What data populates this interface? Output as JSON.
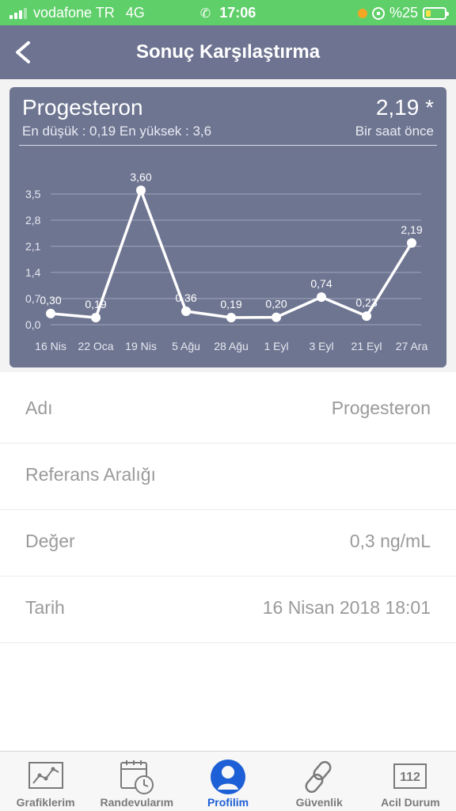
{
  "status_bar": {
    "carrier": "vodafone TR",
    "network": "4G",
    "time": "17:06",
    "battery": "%25",
    "colors": {
      "background": "#5fcf6a"
    }
  },
  "nav": {
    "title": "Sonuç Karşılaştırma",
    "back_icon": "chevron-left-icon"
  },
  "card": {
    "title": "Progesteron",
    "value": "2,19 *",
    "range": "En düşük : 0,19 En yüksek : 3,6",
    "time": "Bir saat önce",
    "colors": {
      "background": "#6e7591",
      "line": "#ffffff"
    }
  },
  "chart_data": {
    "type": "line",
    "categories": [
      "16 Nis",
      "22 Oca",
      "19 Nis",
      "5 Ağu",
      "28 Ağu",
      "1 Eyl",
      "3 Eyl",
      "21 Eyl",
      "27 Ara"
    ],
    "series": [
      {
        "values": [
          0.3,
          0.19,
          3.6,
          0.36,
          0.19,
          0.2,
          0.74,
          0.23,
          2.19
        ]
      }
    ],
    "point_labels": [
      "0,30",
      "0,19",
      "3,60",
      "0,36",
      "0,19",
      "0,20",
      "0,74",
      "0,23",
      "2,19"
    ],
    "y_ticks": [
      0.0,
      0.7,
      1.4,
      2.1,
      2.8,
      3.5
    ],
    "y_tick_labels": [
      "0,0",
      "0,7",
      "1,4",
      "2,1",
      "2,8",
      "3,5"
    ],
    "ylim": [
      0,
      3.5
    ],
    "grid": true
  },
  "rows": [
    {
      "label": "Adı",
      "value": "Progesteron"
    },
    {
      "label": "Referans Aralığı",
      "value": ""
    },
    {
      "label": "Değer",
      "value": "0,3 ng/mL"
    },
    {
      "label": "Tarih",
      "value": "16 Nisan 2018 18:01"
    }
  ],
  "tabs": [
    {
      "label": "Grafiklerim",
      "icon": "chart-icon"
    },
    {
      "label": "Randevularım",
      "icon": "calendar-clock-icon"
    },
    {
      "label": "Profilim",
      "icon": "profile-icon",
      "active": true
    },
    {
      "label": "Güvenlik",
      "icon": "chain-link-icon"
    },
    {
      "label": "Acil Durum",
      "icon": "emergency-112-icon",
      "badge": "112"
    }
  ],
  "colors": {
    "tab_active": "#1d5fd6",
    "tab_inactive": "#7a7a7a"
  }
}
